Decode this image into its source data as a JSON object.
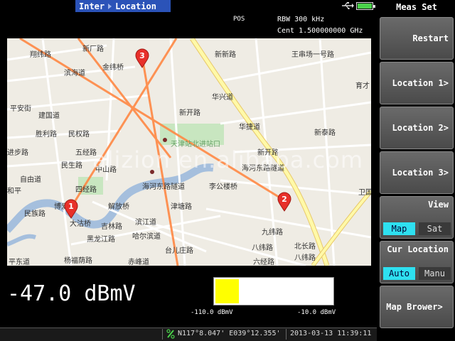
{
  "header": {
    "mode_left": "Inter",
    "mode_right": "Location",
    "pos_label": "POS",
    "rbw": "RBW  300 kHz",
    "cent": "Cent 1.500000000 GHz"
  },
  "map": {
    "markers": [
      "1",
      "2",
      "3"
    ],
    "watermark": "alizion en.alibaba.com",
    "streets": [
      "新厂路",
      "翔纬路",
      "金纬桥",
      "滨海道",
      "新新路",
      "王串场一号路",
      "育才",
      "华兴道",
      "平安街",
      "建国道",
      "新开路",
      "胜利路",
      "民权路",
      "华捷道",
      "新泰路",
      "进步路",
      "五经路",
      "民生路",
      "新开路",
      "中山路",
      "自由道",
      "海河东路隧道",
      "李公楼桥",
      "卫国",
      "四经路",
      "博爱",
      "解放桥",
      "和平",
      "津塘路",
      "民族路",
      "大沽桥",
      "吉林路",
      "滨江道",
      "九纬路",
      "北长路",
      "黑龙江路",
      "哈尔滨道",
      "八纬路",
      "八纬路",
      "平东道",
      "杨福荫路",
      "赤峰道",
      "台儿庄路",
      "六经路",
      "天津站北进站口",
      "海河东路隧道"
    ],
    "colors": {
      "route": "#ff8844",
      "water": "#a5bfdd",
      "road_major": "#fff9a8",
      "road_border": "#e8c86a",
      "marker": "#e8302a",
      "park": "#c8e6c0"
    }
  },
  "measurement": {
    "reading": "-47.0 dBmV",
    "meter_min": "-110.0 dBmV",
    "meter_max": "-10.0 dBmV",
    "meter_fraction": 0.2,
    "meter_color": "#ffff00"
  },
  "status": {
    "coords": "N117°8.047' E039°12.355'",
    "datetime": "2013-03-13 11:39:11"
  },
  "side_menu": {
    "title": "Meas Set",
    "buttons": [
      "Restart",
      "Location 1>",
      "Location 2>",
      "Location 3>"
    ],
    "view": {
      "label": "View",
      "options": [
        "Map",
        "Sat"
      ],
      "selected": "Map"
    },
    "cur_location": {
      "label": "Cur Location",
      "options": [
        "Auto",
        "Manu"
      ],
      "selected": "Auto"
    },
    "map_browser": "Map Brower>"
  },
  "icons": {
    "usb": "usb-icon",
    "battery": "battery-icon",
    "gps": "gps-icon",
    "marker": "map-pin-icon"
  }
}
